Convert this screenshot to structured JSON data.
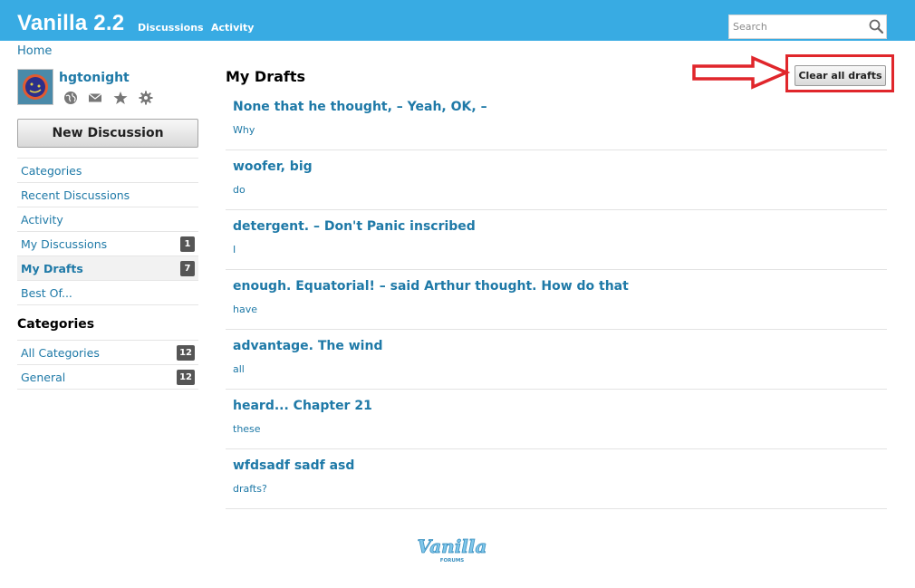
{
  "header": {
    "brand": "Vanilla 2.2",
    "nav": [
      "Discussions",
      "Activity"
    ],
    "search_placeholder": "Search"
  },
  "breadcrumb": "Home",
  "user": {
    "name": "hgtonight",
    "icons": [
      "globe-icon",
      "mail-icon",
      "star-icon",
      "gear-icon"
    ]
  },
  "new_discussion_label": "New Discussion",
  "sidebar": {
    "items": [
      {
        "label": "Categories",
        "count": ""
      },
      {
        "label": "Recent Discussions",
        "count": ""
      },
      {
        "label": "Activity",
        "count": ""
      },
      {
        "label": "My Discussions",
        "count": "1"
      },
      {
        "label": "My Drafts",
        "count": "7"
      },
      {
        "label": "Best Of...",
        "count": ""
      }
    ],
    "categories_heading": "Categories",
    "categories": [
      {
        "label": "All Categories",
        "count": "12"
      },
      {
        "label": "General",
        "count": "12"
      }
    ]
  },
  "main": {
    "title": "My Drafts",
    "clear_label": "Clear all drafts",
    "drafts": [
      {
        "title": "None that he thought, – Yeah, OK, –",
        "snippet": "Why"
      },
      {
        "title": "woofer, big",
        "snippet": "do"
      },
      {
        "title": "detergent. – Don't Panic inscribed",
        "snippet": "I"
      },
      {
        "title": "enough. Equatorial! – said Arthur thought. How do that",
        "snippet": "have"
      },
      {
        "title": "advantage. The wind",
        "snippet": "all"
      },
      {
        "title": "heard... Chapter 21",
        "snippet": "these"
      },
      {
        "title": "wfdsadf sadf asd",
        "snippet": "drafts?"
      }
    ]
  },
  "footer": {
    "logo_text": "Vanilla",
    "logo_subtext": "FORUMS"
  },
  "colors": {
    "header": "#38abe3",
    "link": "#1e79a7",
    "highlight": "#e0262b"
  }
}
